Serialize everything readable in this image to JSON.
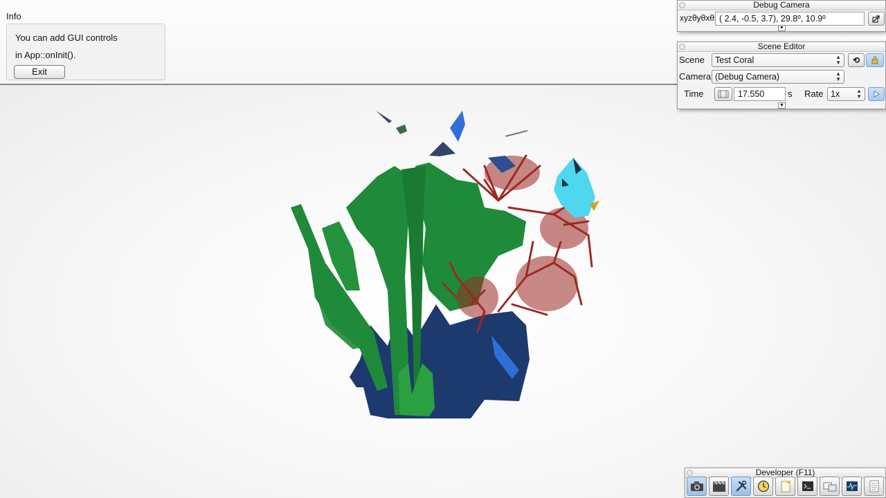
{
  "info": {
    "title": "Info",
    "line1": "You can add GUI controls",
    "line2": "in App::onInit().",
    "exit_label": "Exit"
  },
  "debug_camera": {
    "title": "Debug Camera",
    "label": "xyzθyθxθz",
    "value": "(  2.4,  -0.5,   3.7),  29.8º,  10.9º"
  },
  "scene_editor": {
    "title": "Scene Editor",
    "scene_label": "Scene",
    "scene_value": "Test Coral",
    "camera_label": "Camera",
    "camera_value": "(Debug Camera)",
    "time_label": "Time",
    "time_value": "17.550",
    "time_unit": "s",
    "rate_label": "Rate",
    "rate_value": "1x"
  },
  "developer": {
    "title": "Developer (F11)",
    "tools": [
      {
        "icon": "camera-icon",
        "active": true
      },
      {
        "icon": "clapperboard-icon",
        "active": false
      },
      {
        "icon": "tools-icon",
        "active": true
      },
      {
        "icon": "clock-icon",
        "active": false
      },
      {
        "icon": "note-icon",
        "active": false
      },
      {
        "icon": "terminal-icon",
        "active": false
      },
      {
        "icon": "windows-icon",
        "active": false
      },
      {
        "icon": "profiler-icon",
        "active": false
      },
      {
        "icon": "log-icon",
        "active": false
      }
    ]
  },
  "colors": {
    "coral_green": "#1f8a3a",
    "coral_red": "#9b2a24",
    "coral_blue": "#1d3a6e",
    "fish_cyan": "#4fd7f0",
    "accent_blue": "#2f6fd8"
  }
}
